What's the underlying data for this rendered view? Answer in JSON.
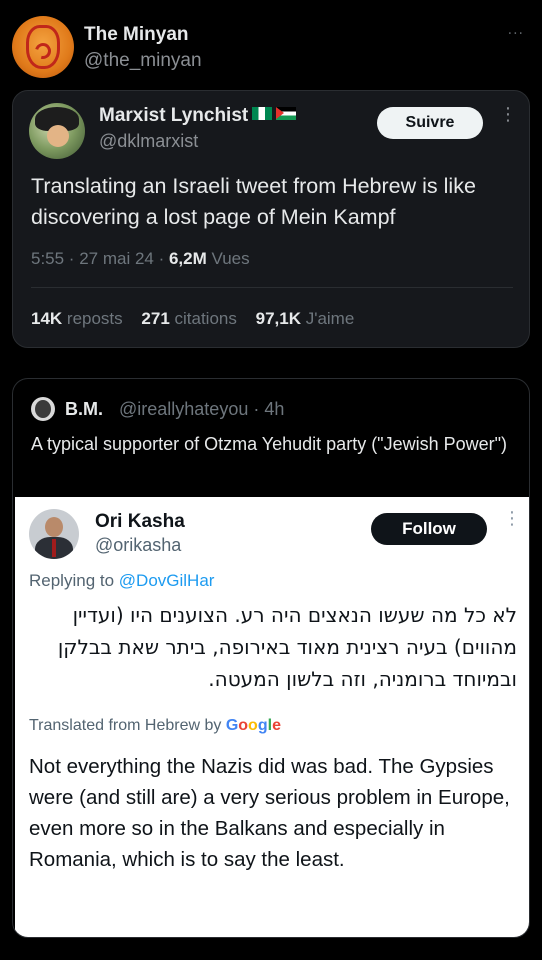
{
  "outer_tweet": {
    "name": "The Minyan",
    "handle": "@the_minyan",
    "more": "···"
  },
  "quoted_tweet": {
    "name": "Marxist Lynchist",
    "handle": "@dklmarxist",
    "follow_label": "Suivre",
    "more": "⋮",
    "text": "Translating an Israeli tweet from Hebrew is like discovering a lost page of Mein Kampf",
    "time": "5:55 · 27 mai 24 · ",
    "views_count": "6,2M",
    "views_label": " Vues",
    "stats": [
      {
        "count": "14K",
        "label": " reposts"
      },
      {
        "count": "271",
        "label": " citations"
      },
      {
        "count": "97,1K",
        "label": " J'aime"
      }
    ]
  },
  "nested_quote": {
    "name": "B.M.",
    "handle": "@ireallyhateyou · 4h",
    "text": "A typical supporter of Otzma Yehudit party (\"Jewish Power\")",
    "screenshot": {
      "name": "Ori Kasha",
      "handle": "@orikasha",
      "follow_label": "Follow",
      "more": "⋮",
      "replying_prefix": "Replying to ",
      "replying_mention": "@DovGilHar",
      "hebrew_text": "לא כל מה שעשו הנאצים היה רע. הצוענים היו (ועדיין מהווים) בעיה רצינית מאוד באירופה, ביתר שאת בבלקן ובמיוחד ברומניה, וזה בלשון המעטה.",
      "translated_label": "Translated from Hebrew by ",
      "google_letters": [
        "G",
        "o",
        "o",
        "g",
        "l",
        "e"
      ],
      "english_text": "Not everything the Nazis did was bad. The Gypsies were (and still are) a very serious problem in Europe, even more so in the Balkans and especially in Romania, which is to say the least."
    }
  }
}
